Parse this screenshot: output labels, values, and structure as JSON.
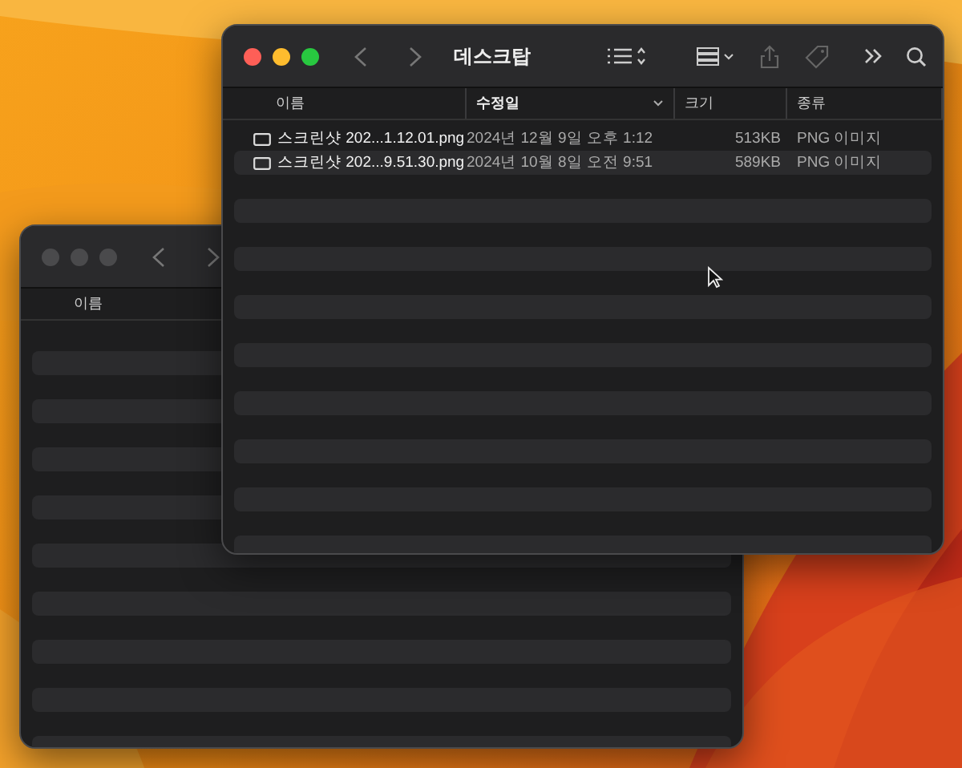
{
  "back_window": {
    "focused": false,
    "columns": [
      {
        "label": "이름"
      }
    ]
  },
  "front_window": {
    "focused": true,
    "title": "데스크탑",
    "columns": [
      {
        "label": "이름",
        "sorted": false
      },
      {
        "label": "수정일",
        "sorted": true
      },
      {
        "label": "크기",
        "sorted": false
      },
      {
        "label": "종류",
        "sorted": false
      }
    ],
    "files": [
      {
        "name": "스크린샷 202...1.12.01.png",
        "modified": "2024년 12월 9일 오후 1:12",
        "size": "513KB",
        "kind": "PNG 이미지"
      },
      {
        "name": "스크린샷 202...9.51.30.png",
        "modified": "2024년 10월 8일 오전 9:51",
        "size": "589KB",
        "kind": "PNG 이미지"
      }
    ]
  }
}
